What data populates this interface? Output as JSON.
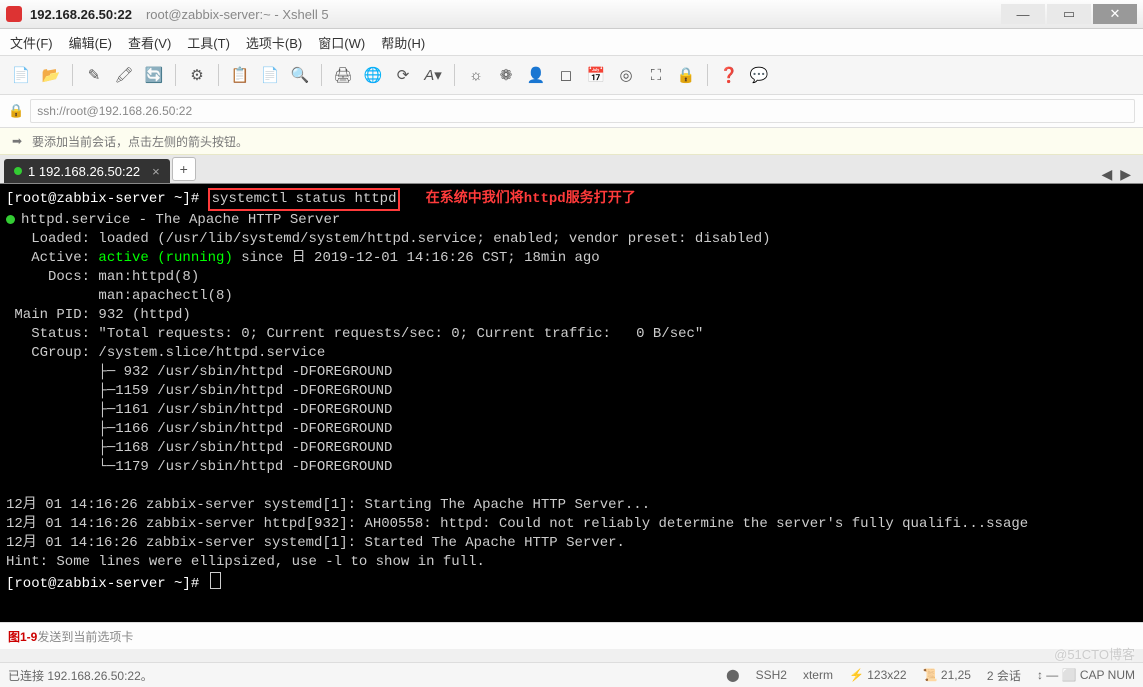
{
  "title": {
    "ip": "192.168.26.50:22",
    "sub": "root@zabbix-server:~ - Xshell 5"
  },
  "menu": {
    "file": "文件(F)",
    "edit": "编辑(E)",
    "view": "查看(V)",
    "tools": "工具(T)",
    "tab": "选项卡(B)",
    "window": "窗口(W)",
    "help": "帮助(H)"
  },
  "address": {
    "value": "ssh://root@192.168.26.50:22"
  },
  "notice": {
    "text": "要添加当前会话，点击左侧的箭头按钮。"
  },
  "tabs": {
    "active": "1 192.168.26.50:22"
  },
  "term": {
    "prompt": "[root@zabbix-server ~]# ",
    "cmd": "systemctl status httpd",
    "note": "在系统中我们将httpd服务打开了",
    "l1": "httpd.service - The Apache HTTP Server",
    "l2": "   Loaded: loaded (/usr/lib/systemd/system/httpd.service; enabled; vendor preset: disabled)",
    "l3a": "   Active: ",
    "l3b": "active (running)",
    "l3c": " since 日 2019-12-01 14:16:26 CST; 18min ago",
    "l4": "     Docs: man:httpd(8)",
    "l5": "           man:apachectl(8)",
    "l6": " Main PID: 932 (httpd)",
    "l7": "   Status: \"Total requests: 0; Current requests/sec: 0; Current traffic:   0 B/sec\"",
    "l8": "   CGroup: /system.slice/httpd.service",
    "p1": "           ├─ 932 /usr/sbin/httpd -DFOREGROUND",
    "p2": "           ├─1159 /usr/sbin/httpd -DFOREGROUND",
    "p3": "           ├─1161 /usr/sbin/httpd -DFOREGROUND",
    "p4": "           ├─1166 /usr/sbin/httpd -DFOREGROUND",
    "p5": "           ├─1168 /usr/sbin/httpd -DFOREGROUND",
    "p6": "           └─1179 /usr/sbin/httpd -DFOREGROUND",
    "log1": "12月 01 14:16:26 zabbix-server systemd[1]: Starting The Apache HTTP Server...",
    "log2": "12月 01 14:16:26 zabbix-server httpd[932]: AH00558: httpd: Could not reliably determine the server's fully qualifi...ssage",
    "log3": "12月 01 14:16:26 zabbix-server systemd[1]: Started The Apache HTTP Server.",
    "hint": "Hint: Some lines were ellipsized, use -l to show in full.",
    "prompt2": "[root@zabbix-server ~]# "
  },
  "send": {
    "fig": "图1-9",
    "hint": "发送到当前选项卡"
  },
  "status": {
    "conn": "已连接 192.168.26.50:22。",
    "proto": "SSH2",
    "term": "xterm",
    "size": "123x22",
    "pos": "21,25",
    "sess": "2 会话"
  },
  "watermark": "@51CTO博客"
}
